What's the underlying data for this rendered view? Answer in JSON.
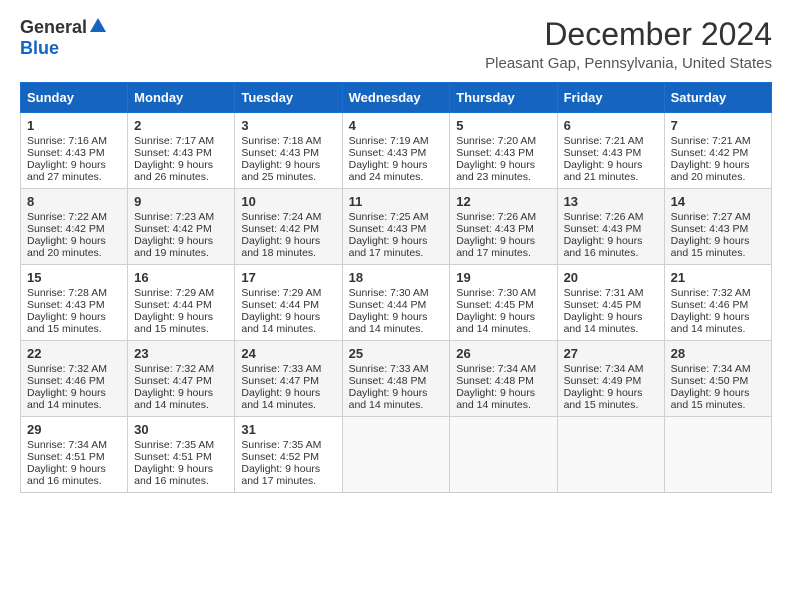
{
  "logo": {
    "general": "General",
    "blue": "Blue"
  },
  "title": "December 2024",
  "location": "Pleasant Gap, Pennsylvania, United States",
  "days_of_week": [
    "Sunday",
    "Monday",
    "Tuesday",
    "Wednesday",
    "Thursday",
    "Friday",
    "Saturday"
  ],
  "weeks": [
    [
      {
        "day": "1",
        "sunrise": "7:16 AM",
        "sunset": "4:43 PM",
        "daylight": "9 hours and 27 minutes."
      },
      {
        "day": "2",
        "sunrise": "7:17 AM",
        "sunset": "4:43 PM",
        "daylight": "9 hours and 26 minutes."
      },
      {
        "day": "3",
        "sunrise": "7:18 AM",
        "sunset": "4:43 PM",
        "daylight": "9 hours and 25 minutes."
      },
      {
        "day": "4",
        "sunrise": "7:19 AM",
        "sunset": "4:43 PM",
        "daylight": "9 hours and 24 minutes."
      },
      {
        "day": "5",
        "sunrise": "7:20 AM",
        "sunset": "4:43 PM",
        "daylight": "9 hours and 23 minutes."
      },
      {
        "day": "6",
        "sunrise": "7:21 AM",
        "sunset": "4:43 PM",
        "daylight": "9 hours and 21 minutes."
      },
      {
        "day": "7",
        "sunrise": "7:21 AM",
        "sunset": "4:42 PM",
        "daylight": "9 hours and 20 minutes."
      }
    ],
    [
      {
        "day": "8",
        "sunrise": "7:22 AM",
        "sunset": "4:42 PM",
        "daylight": "9 hours and 20 minutes."
      },
      {
        "day": "9",
        "sunrise": "7:23 AM",
        "sunset": "4:42 PM",
        "daylight": "9 hours and 19 minutes."
      },
      {
        "day": "10",
        "sunrise": "7:24 AM",
        "sunset": "4:42 PM",
        "daylight": "9 hours and 18 minutes."
      },
      {
        "day": "11",
        "sunrise": "7:25 AM",
        "sunset": "4:43 PM",
        "daylight": "9 hours and 17 minutes."
      },
      {
        "day": "12",
        "sunrise": "7:26 AM",
        "sunset": "4:43 PM",
        "daylight": "9 hours and 17 minutes."
      },
      {
        "day": "13",
        "sunrise": "7:26 AM",
        "sunset": "4:43 PM",
        "daylight": "9 hours and 16 minutes."
      },
      {
        "day": "14",
        "sunrise": "7:27 AM",
        "sunset": "4:43 PM",
        "daylight": "9 hours and 15 minutes."
      }
    ],
    [
      {
        "day": "15",
        "sunrise": "7:28 AM",
        "sunset": "4:43 PM",
        "daylight": "9 hours and 15 minutes."
      },
      {
        "day": "16",
        "sunrise": "7:29 AM",
        "sunset": "4:44 PM",
        "daylight": "9 hours and 15 minutes."
      },
      {
        "day": "17",
        "sunrise": "7:29 AM",
        "sunset": "4:44 PM",
        "daylight": "9 hours and 14 minutes."
      },
      {
        "day": "18",
        "sunrise": "7:30 AM",
        "sunset": "4:44 PM",
        "daylight": "9 hours and 14 minutes."
      },
      {
        "day": "19",
        "sunrise": "7:30 AM",
        "sunset": "4:45 PM",
        "daylight": "9 hours and 14 minutes."
      },
      {
        "day": "20",
        "sunrise": "7:31 AM",
        "sunset": "4:45 PM",
        "daylight": "9 hours and 14 minutes."
      },
      {
        "day": "21",
        "sunrise": "7:32 AM",
        "sunset": "4:46 PM",
        "daylight": "9 hours and 14 minutes."
      }
    ],
    [
      {
        "day": "22",
        "sunrise": "7:32 AM",
        "sunset": "4:46 PM",
        "daylight": "9 hours and 14 minutes."
      },
      {
        "day": "23",
        "sunrise": "7:32 AM",
        "sunset": "4:47 PM",
        "daylight": "9 hours and 14 minutes."
      },
      {
        "day": "24",
        "sunrise": "7:33 AM",
        "sunset": "4:47 PM",
        "daylight": "9 hours and 14 minutes."
      },
      {
        "day": "25",
        "sunrise": "7:33 AM",
        "sunset": "4:48 PM",
        "daylight": "9 hours and 14 minutes."
      },
      {
        "day": "26",
        "sunrise": "7:34 AM",
        "sunset": "4:48 PM",
        "daylight": "9 hours and 14 minutes."
      },
      {
        "day": "27",
        "sunrise": "7:34 AM",
        "sunset": "4:49 PM",
        "daylight": "9 hours and 15 minutes."
      },
      {
        "day": "28",
        "sunrise": "7:34 AM",
        "sunset": "4:50 PM",
        "daylight": "9 hours and 15 minutes."
      }
    ],
    [
      {
        "day": "29",
        "sunrise": "7:34 AM",
        "sunset": "4:51 PM",
        "daylight": "9 hours and 16 minutes."
      },
      {
        "day": "30",
        "sunrise": "7:35 AM",
        "sunset": "4:51 PM",
        "daylight": "9 hours and 16 minutes."
      },
      {
        "day": "31",
        "sunrise": "7:35 AM",
        "sunset": "4:52 PM",
        "daylight": "9 hours and 17 minutes."
      },
      null,
      null,
      null,
      null
    ]
  ],
  "labels": {
    "sunrise": "Sunrise:",
    "sunset": "Sunset:",
    "daylight": "Daylight:"
  }
}
